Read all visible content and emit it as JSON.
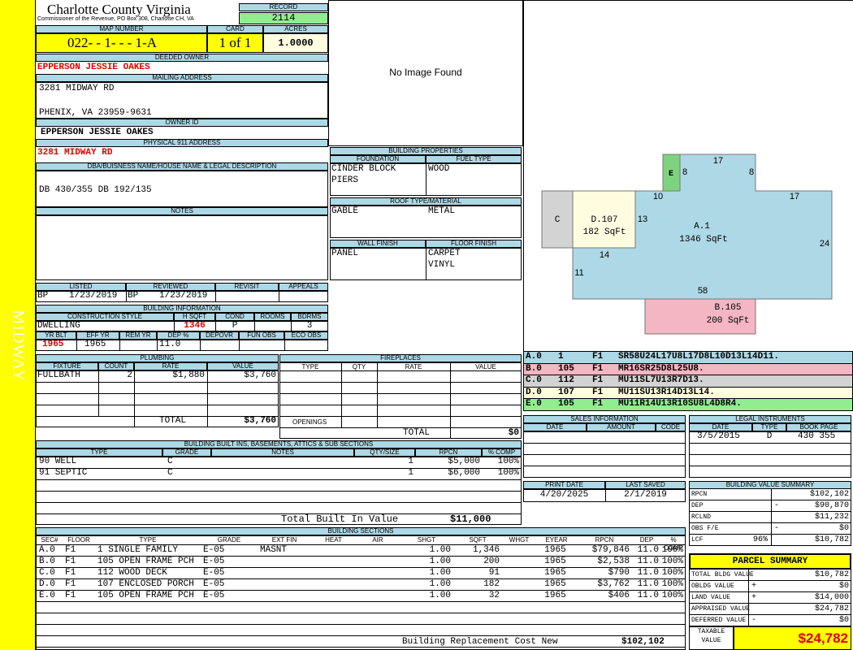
{
  "side_label": "MIDWAY",
  "county": {
    "name": "Charlotte County Virginia",
    "sub": "Commissioner of the Revenue, PO Box 308, Charlotte CH, VA"
  },
  "record": {
    "label": "RECORD",
    "value": "2114"
  },
  "map": {
    "label": "MAP NUMBER",
    "value": "022- - 1- - - 1-A"
  },
  "card": {
    "label": "CARD",
    "value": "1 of 1"
  },
  "acres": {
    "label": "ACRES",
    "value": "1.0000"
  },
  "deeded_owner": {
    "label": "DEEDED OWNER",
    "value": "EPPERSON JESSIE OAKES"
  },
  "mailing": {
    "label": "MAILING ADDRESS",
    "line1": "3281 MIDWAY RD",
    "line2": "PHENIX, VA 23959-9631"
  },
  "owner_id": {
    "label": "OWNER ID",
    "value": "EPPERSON JESSIE OAKES"
  },
  "physical": {
    "label": "PHYSICAL 911 ADDRESS",
    "value": "3281 MIDWAY RD"
  },
  "dba": {
    "label": "DBA/BUISNESS NAME/HOUSE NAME & LEGAL DESCRIPTION",
    "value": "DB 430/355 DB 192/135"
  },
  "notes": {
    "label": "NOTES"
  },
  "listing": {
    "h_listed": "LISTED",
    "h_reviewed": "REVIEWED",
    "h_revisit": "REVISIT",
    "h_appeals": "APPEALS",
    "listed_by": "BP",
    "listed_date": "1/23/2019",
    "reviewed_by": "BP",
    "reviewed_date": "1/23/2019"
  },
  "building_info": {
    "label": "BUILDING INFORMATION",
    "h_style": "CONSTRUCTION STYLE",
    "h_hsqft": "H SQFT",
    "h_cond": "COND",
    "h_rooms": "ROOMS",
    "h_bdrms": "BDRMS",
    "style": "DWELLING",
    "hsqft": "1346",
    "cond": "P",
    "bdrms": "3",
    "h_yrblt": "YR BLT",
    "h_effyr": "EFF YR",
    "h_remyr": "REM YR",
    "h_dep": "DEP %",
    "h_depovr": "DEPOVR",
    "h_funobs": "FUN OBS",
    "h_ecoobs": "ECO OBS",
    "yrblt": "1965",
    "effyr": "1965",
    "dep": "11.0"
  },
  "no_image": "No Image Found",
  "building_props": {
    "label": "BUILDING PROPERTIES",
    "h_foundation": "FOUNDATION",
    "h_fuel": "FUEL TYPE",
    "foundation1": "CINDER BLOCK",
    "foundation2": "PIERS",
    "fuel": "WOOD",
    "h_roof": "ROOF TYPE/MATERIAL",
    "roof_type": "GABLE",
    "roof_mat": "METAL",
    "h_wall": "WALL FINISH",
    "h_floor": "FLOOR FINISH",
    "wall": "PANEL",
    "floor1": "CARPET",
    "floor2": "VINYL"
  },
  "sketch": {
    "a": {
      "name": "A.1",
      "area": "1346 SqFt"
    },
    "b": {
      "name": "B.105",
      "area": "200 SqFt"
    },
    "c": {
      "name": "C"
    },
    "d": {
      "name": "D.107",
      "area": "182 SqFt"
    },
    "e": {
      "name": "E"
    },
    "dims": [
      "17",
      "8",
      "8",
      "10",
      "17",
      "13",
      "24",
      "14",
      "11",
      "58"
    ],
    "colors": {
      "a": "#add8e6",
      "b": "#f4b6c2",
      "c": "#d3d3d3",
      "d": "#fffce0",
      "e": "#7ed47e"
    }
  },
  "vectors": [
    {
      "sec": "A.0",
      "code": "1",
      "fl": "F1",
      "vec": "SR58U24L17U8L17D8L10D13L14D11.",
      "color": "#add8e6"
    },
    {
      "sec": "B.0",
      "code": "105",
      "fl": "F1",
      "vec": "MR16SR25D8L25U8.",
      "color": "#f4b6c2"
    },
    {
      "sec": "C.0",
      "code": "112",
      "fl": "F1",
      "vec": "MU11SL7U13R7D13.",
      "color": "#d3d3d3"
    },
    {
      "sec": "D.0",
      "code": "107",
      "fl": "F1",
      "vec": "MU11SU13R14D13L14.",
      "color": "#fffce0"
    },
    {
      "sec": "E.0",
      "code": "105",
      "fl": "F1",
      "vec": "MU11R14U13R10SU8L4D8R4.",
      "color": "#90ee90"
    }
  ],
  "plumbing": {
    "label": "PLUMBING",
    "h_fixture": "FIXTURE",
    "h_count": "COUNT",
    "h_rate": "RATE",
    "h_value": "VALUE",
    "rows": [
      {
        "fixture": "FULLBATH",
        "count": "2",
        "rate": "$1,880",
        "value": "$3,760"
      }
    ],
    "total_label": "TOTAL",
    "total": "$3,760"
  },
  "fireplaces": {
    "label": "FIREPLACES",
    "h_type": "TYPE",
    "h_qty": "QTY",
    "h_rate": "RATE",
    "h_value": "VALUE",
    "openings": "OPENINGS",
    "total_label": "TOTAL",
    "total": "$0"
  },
  "sales": {
    "label": "SALES INFORMATION",
    "h_date": "DATE",
    "h_amount": "AMOUNT",
    "h_code": "CODE"
  },
  "legal": {
    "label": "LEGAL INSTRUMENTS",
    "h_date": "DATE",
    "h_type": "TYPE",
    "h_book": "BOOK PAGE",
    "date": "3/5/2015",
    "type": "D",
    "book": "430 355"
  },
  "built_ins": {
    "label": "BUILDING BUILT INS, BASEMENTS, ATTICS & SUB SECTIONS",
    "h_type": "TYPE",
    "h_grade": "GRADE",
    "h_notes": "NOTES",
    "h_qty": "QTY/SIZE",
    "h_rpcn": "RPCN",
    "h_comp": "% COMP",
    "rows": [
      {
        "type": "90 WELL",
        "grade": "C",
        "qty": "1",
        "rpcn": "$5,000",
        "comp": "100%"
      },
      {
        "type": "91 SEPTIC",
        "grade": "C",
        "qty": "1",
        "rpcn": "$6,000",
        "comp": "100%"
      }
    ],
    "total_label": "Total Built In Value",
    "total": "$11,000"
  },
  "print": {
    "h_print": "PRINT DATE",
    "h_saved": "LAST SAVED",
    "print_date": "4/20/2025",
    "last_saved": "2/1/2019"
  },
  "value_summary": {
    "label": "BUILDING VALUE SUMMARY",
    "rows": [
      {
        "k": "RPCN",
        "sign": "",
        "v": "$102,102"
      },
      {
        "k": "DEP",
        "sign": "-",
        "v": "$90,870"
      },
      {
        "k": "RCLND",
        "sign": "",
        "v": "$11,232"
      },
      {
        "k": "OBS F/E",
        "sign": "-",
        "v": "$0"
      },
      {
        "k": "LCF",
        "pct": "96%",
        "sign": "",
        "v": "$10,782"
      }
    ]
  },
  "parcel": {
    "label": "PARCEL SUMMARY",
    "rows": [
      {
        "k": "TOTAL BLDG VALUE",
        "sign": "",
        "v": "$10,782"
      },
      {
        "k": "OBLDG VALUE",
        "sign": "+",
        "v": "$0"
      },
      {
        "k": "LAND VALUE",
        "sign": "+",
        "v": "$14,000"
      },
      {
        "k": "APPRAISED VALUE",
        "sign": "",
        "v": "$24,782"
      },
      {
        "k": "DEFERRED VALUE",
        "sign": "-",
        "v": "$0"
      }
    ],
    "taxable_label1": "TAXABLE",
    "taxable_label2": "VALUE",
    "taxable": "$24,782"
  },
  "sections": {
    "label": "BUILDING SECTIONS",
    "headers": [
      "SEC#",
      "FLOOR",
      "TYPE",
      "GRADE",
      "EXT FIN",
      "HEAT",
      "AIR",
      "SHGT",
      "SQFT",
      "WHGT",
      "EYEAR",
      "RPCN",
      "DEP",
      "% COMP"
    ],
    "rows": [
      [
        "A.0",
        "F1",
        "1 SINGLE FAMILY",
        "E-05",
        "MASNT",
        "",
        "",
        "1.00",
        "1,346",
        "",
        "1965",
        "$79,846",
        "11.0",
        "100%"
      ],
      [
        "B.0",
        "F1",
        "105 OPEN FRAME PCH",
        "E-05",
        "",
        "",
        "",
        "1.00",
        "200",
        "",
        "1965",
        "$2,538",
        "11.0",
        "100%"
      ],
      [
        "C.0",
        "F1",
        "112 WOOD DECK",
        "E-05",
        "",
        "",
        "",
        "1.00",
        "91",
        "",
        "1965",
        "$790",
        "11.0",
        "100%"
      ],
      [
        "D.0",
        "F1",
        "107 ENCLOSED PORCH",
        "E-05",
        "",
        "",
        "",
        "1.00",
        "182",
        "",
        "1965",
        "$3,762",
        "11.0",
        "100%"
      ],
      [
        "E.0",
        "F1",
        "105 OPEN FRAME PCH",
        "E-05",
        "",
        "",
        "",
        "1.00",
        "32",
        "",
        "1965",
        "$406",
        "11.0",
        "100%"
      ]
    ],
    "brcn_label": "Building Replacement Cost New",
    "brcn": "$102,102"
  }
}
